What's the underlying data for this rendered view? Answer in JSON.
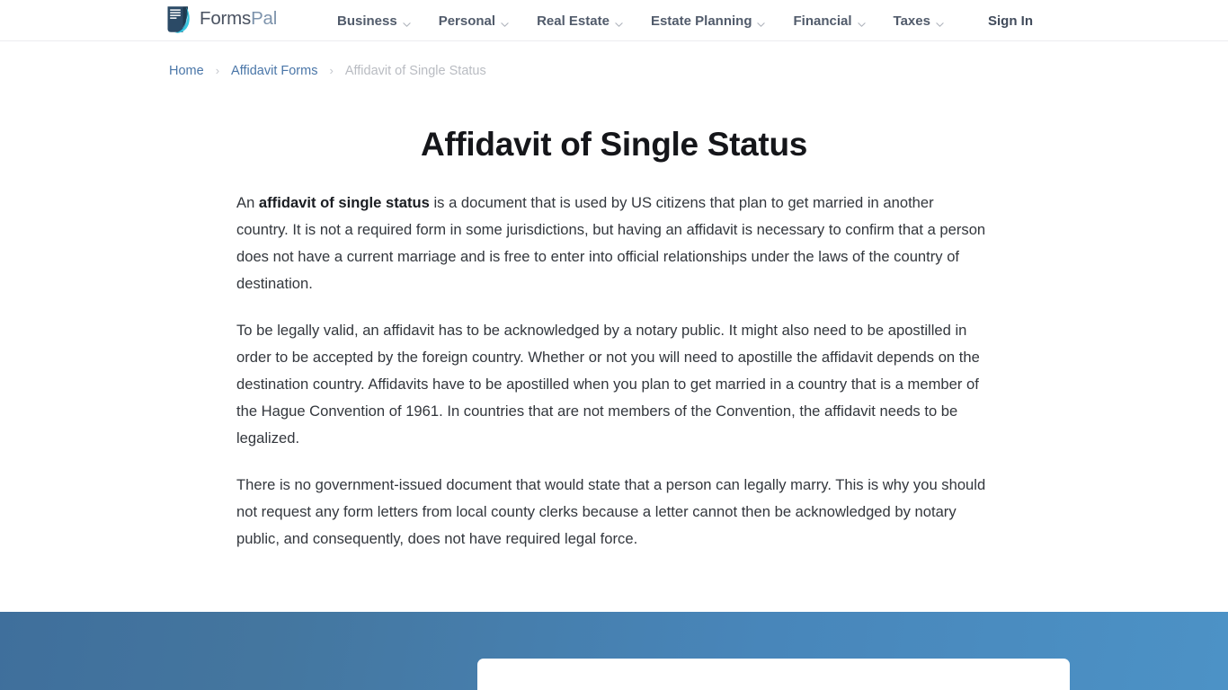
{
  "header": {
    "logo": {
      "icon": "formspal-document-logo-icon",
      "text_primary": "Forms",
      "text_secondary": "Pal"
    },
    "nav_items": [
      {
        "label": "Business",
        "icon": "chevron-down-icon",
        "has_dropdown": true
      },
      {
        "label": "Personal",
        "icon": "chevron-down-icon",
        "has_dropdown": true
      },
      {
        "label": "Real Estate",
        "icon": "chevron-down-icon",
        "has_dropdown": true
      },
      {
        "label": "Estate Planning",
        "icon": "chevron-down-icon",
        "has_dropdown": true
      },
      {
        "label": "Financial",
        "icon": "chevron-down-icon",
        "has_dropdown": true
      },
      {
        "label": "Taxes",
        "icon": "chevron-down-icon",
        "has_dropdown": true
      }
    ],
    "sign_in_label": "Sign In"
  },
  "breadcrumb": {
    "separator": "›",
    "items": [
      {
        "label": "Home",
        "current": false
      },
      {
        "label": "Affidavit Forms",
        "current": false
      },
      {
        "label": "Affidavit of Single Status",
        "current": true
      }
    ]
  },
  "main": {
    "title": "Affidavit of Single Status",
    "paragraphs": [
      {
        "lead": "An ",
        "bold": "affidavit of single status",
        "rest": " is a document that is used by US citizens that plan to get married in another country. It is not a required form in some jurisdictions, but having an affidavit is necessary to confirm that a person does not have a current marriage and is free to enter into official relationships under the laws of the country of destination."
      },
      {
        "text": "To be legally valid, an affidavit has to be acknowledged by a notary public. It might also need to be apostilled in order to be accepted by the foreign country. Whether or not you will need to apostille the affidavit depends on the destination country. Affidavits have to be apostilled when you plan to get married in a country that is a member of the Hague Convention of 1961. In countries that are not members of the Convention, the affidavit needs to be legalized."
      },
      {
        "text": "There is no government-issued document that would state that a person can legally marry. This is why you should not request any form letters from local county clerks because a letter cannot then be acknowledged by notary public, and consequently, does not have required legal force."
      }
    ]
  },
  "cta_band": {
    "gradient_start": "#3f6f9c",
    "gradient_end": "#4c92c6",
    "card_background": "#ffffff"
  },
  "colors": {
    "nav_text": "#515b6b",
    "link_blue": "#4a76a8",
    "breadcrumb_current": "#b9bcc2",
    "body_text": "#33373d",
    "title": "#15161a",
    "logo_primary": "#4a5261",
    "logo_secondary": "#7d93ac",
    "header_border": "#ececf0"
  }
}
